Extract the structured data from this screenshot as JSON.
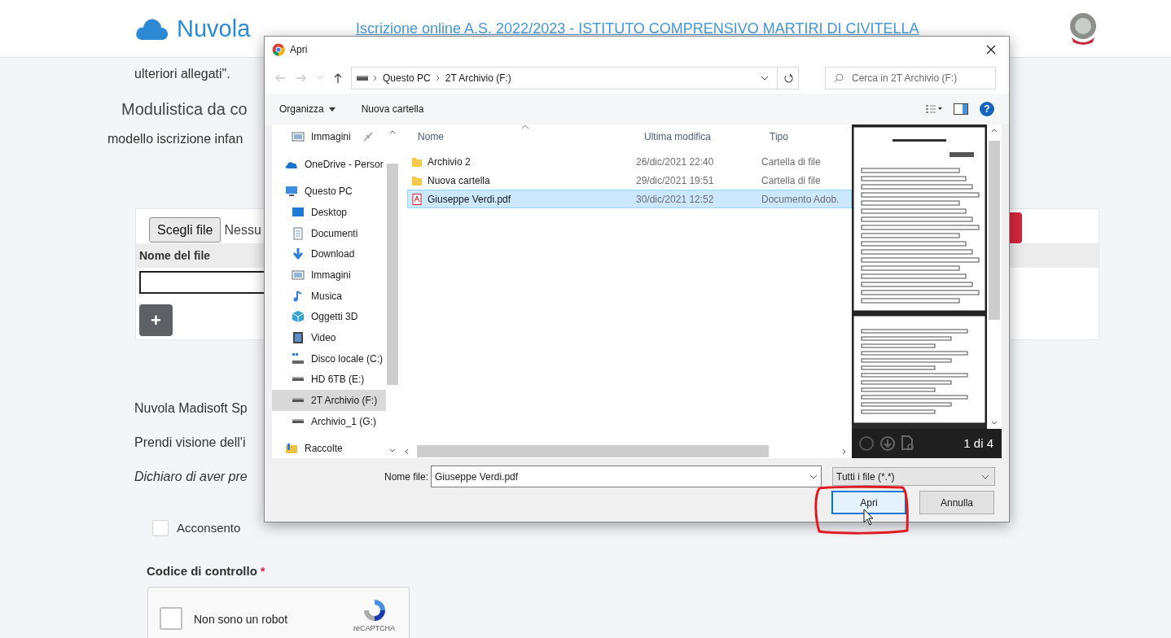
{
  "header": {
    "logo": "Nuvola",
    "title": "Iscrizione online A.S. 2022/2023 - ISTITUTO COMPRENSIVO MARTIRI DI CIVITELLA"
  },
  "page": {
    "intro": "ulteriori allegati\".",
    "section_title": "Modulistica da co",
    "section_text": "modello iscrizione infan",
    "upload": {
      "choose_button": "Scegli file",
      "status": "Nessu",
      "name_label": "Nome del file",
      "add_button": "+"
    },
    "paragraphs": [
      {
        "text": "Nuvola Madisoft Sp",
        "italic": false
      },
      {
        "text": "Prendi visione dell'i",
        "italic": false
      },
      {
        "text": "Dichiaro di aver pre",
        "italic": true
      }
    ],
    "consent": {
      "label": "Acconsento",
      "checked": false
    },
    "captcha_label": "Codice di controllo",
    "required_mark": "*",
    "captcha": {
      "label": "Non sono un robot",
      "checked": false,
      "brand": "reCAPTCHA"
    }
  },
  "dialog": {
    "title": "Apri",
    "breadcrumbs": [
      "Questo PC",
      "2T Archivio (F:)"
    ],
    "search_placeholder": "Cerca in 2T Archivio (F:)",
    "toolbar": {
      "organize": "Organizza",
      "new_folder": "Nuova cartella",
      "help": "?"
    },
    "nav_items": [
      {
        "label": "Immagini",
        "kind": "pictures",
        "pinned": true,
        "selected": false
      },
      {
        "label": "OneDrive - Persor",
        "kind": "cloud",
        "pinned": false,
        "selected": false
      },
      {
        "label": "Questo PC",
        "kind": "pc",
        "pinned": false,
        "selected": false,
        "children": [
          {
            "label": "Desktop",
            "kind": "desktop",
            "pinned": false,
            "selected": false
          },
          {
            "label": "Documenti",
            "kind": "documents",
            "pinned": false,
            "selected": false
          },
          {
            "label": "Download",
            "kind": "download",
            "pinned": false,
            "selected": false
          },
          {
            "label": "Immagini",
            "kind": "pictures",
            "pinned": false,
            "selected": false
          },
          {
            "label": "Musica",
            "kind": "music",
            "pinned": false,
            "selected": false
          },
          {
            "label": "Oggetti 3D",
            "kind": "objects",
            "pinned": false,
            "selected": false
          },
          {
            "label": "Video",
            "kind": "video",
            "pinned": false,
            "selected": false
          },
          {
            "label": "Disco locale (C:)",
            "kind": "system-drive",
            "pinned": false,
            "selected": false
          },
          {
            "label": "HD 6TB (E:)",
            "kind": "drive",
            "pinned": false,
            "selected": false
          },
          {
            "label": "2T Archivio (F:)",
            "kind": "drive",
            "pinned": false,
            "selected": true
          },
          {
            "label": "Archivio_1 (G:)",
            "kind": "drive",
            "pinned": false,
            "selected": false
          }
        ]
      },
      {
        "label": "Raccolte",
        "kind": "library",
        "pinned": false,
        "selected": false
      }
    ],
    "columns": [
      "Nome",
      "Ultima modifica",
      "Tipo"
    ],
    "files": [
      {
        "name": "Archivio 2",
        "modified": "26/dic/2021 22:40",
        "type": "Cartella di file",
        "kind": "folder",
        "selected": false
      },
      {
        "name": "Nuova cartella",
        "modified": "29/dic/2021 19:51",
        "type": "Cartella di file",
        "kind": "folder",
        "selected": false
      },
      {
        "name": "Giuseppe Verdi.pdf",
        "modified": "30/dic/2021 12:52",
        "type": "Documento Adob.",
        "kind": "pdf",
        "selected": true
      }
    ],
    "preview": {
      "page_count": "1 di 4"
    },
    "file_name_label": "Nome file:",
    "file_name": "Giuseppe Verdi.pdf",
    "filter": "Tutti i file (*.*)",
    "buttons": [
      {
        "label": "Apri",
        "focused": true
      },
      {
        "label": "Annulla",
        "focused": false
      }
    ]
  }
}
